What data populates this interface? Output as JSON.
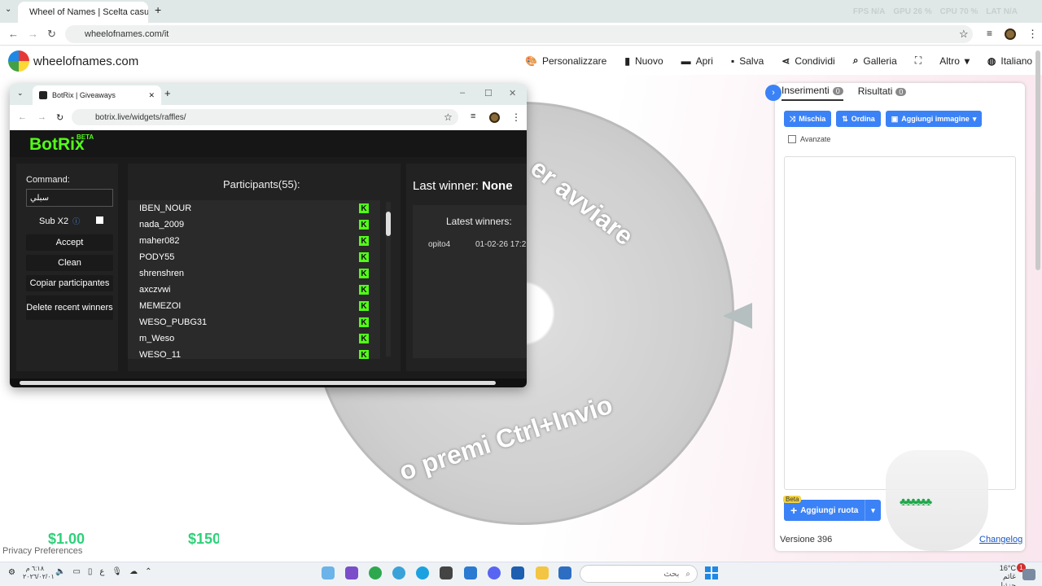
{
  "browser": {
    "tab_title": "Wheel of Names | Scelta casual",
    "url": "wheelofnames.com/it",
    "perf": [
      "FPS N/A",
      "GPU 26 %",
      "CPU 70 %",
      "LAT N/A"
    ]
  },
  "site": {
    "brand": "wheelofnames.com",
    "menu": [
      "Personalizzare",
      "Nuovo",
      "Apri",
      "Salva",
      "Condividi",
      "Galleria",
      "Altro",
      "Italiano"
    ]
  },
  "wheel": {
    "text_top": "er avviare",
    "text_bottom": "o premi Ctrl+Invio"
  },
  "right_panel": {
    "tab_entries": "Inserimenti",
    "tab_entries_count": "0",
    "tab_results": "Risultati",
    "tab_results_count": "0",
    "btn_shuffle": "Mischia",
    "btn_sort": "Ordina",
    "btn_add_image": "Aggiungi immagine",
    "advanced_label": "Avanzate",
    "add_wheel_badge": "Beta",
    "add_wheel": "Aggiungi ruota",
    "version": "Versione 396",
    "changelog": "Changelog"
  },
  "botrix_window": {
    "tab_title": "BotRix | Giveaways",
    "url": "botrix.live/widgets/raffles/",
    "logo": "BotRix",
    "beta": "BETA",
    "command_label": "Command:",
    "command_value": "سبلي",
    "sub_label": "Sub X2",
    "accept": "Accept",
    "clean": "Clean",
    "copy": "Copiar participantes",
    "delete": "Delete recent winners",
    "participants_title": "Participants(55):",
    "participants": [
      "IBEN_NOUR",
      "nada_2009",
      "maher082",
      "PODY55",
      "shrenshren",
      "axczvwi",
      "MEMEZOI",
      "WESO_PUBG31",
      "m_Weso",
      "WESO_11"
    ],
    "last_winner_label": "Last winner:",
    "last_winner_value": "None",
    "latest_winners": "Latest winners:",
    "winner_name": "opito4",
    "winner_date": "01-02-26 17:2"
  },
  "ticker": {
    "amount1": "$1.00",
    "amount2": "$150",
    "privacy": "Privacy Preferences"
  },
  "taskbar": {
    "search_placeholder": "بحث",
    "weather_temp": "16°C",
    "weather_desc": "غائم جزئيا",
    "notif_count": "1",
    "clock_time": "٦:١٨ م",
    "clock_date": "٢٠٢٦/٠٢/٠١",
    "lang": "ع"
  },
  "colors": {
    "accent": "#3b82f6",
    "kick_green": "#53fc18",
    "ticker_green": "#2fd07a"
  }
}
